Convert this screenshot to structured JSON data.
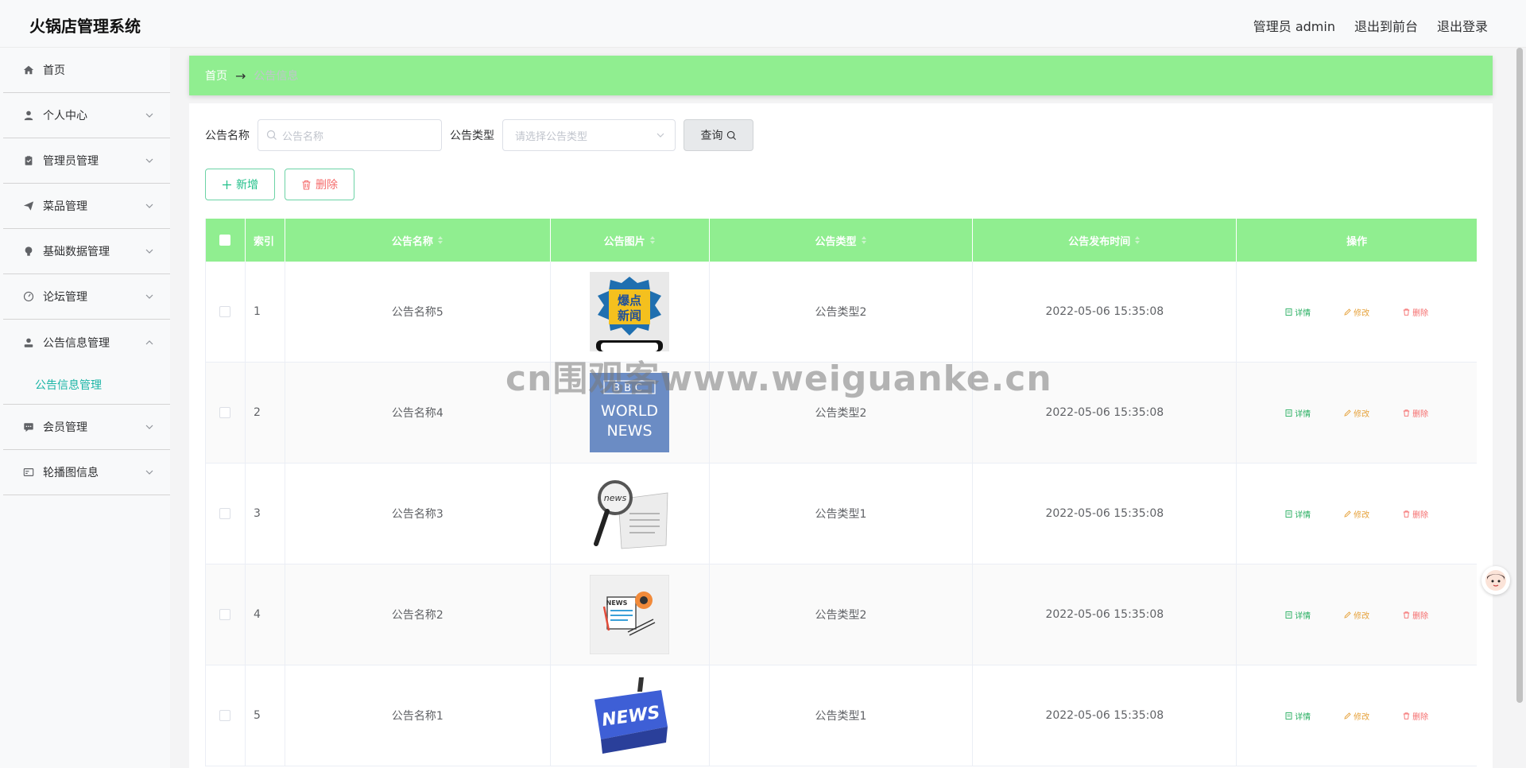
{
  "header": {
    "title": "火锅店管理系统",
    "user": "管理员 admin",
    "to_front": "退出到前台",
    "logout": "退出登录"
  },
  "sidebar": {
    "items": [
      {
        "label": "首页",
        "icon": "home-icon"
      },
      {
        "label": "个人中心",
        "icon": "user-icon"
      },
      {
        "label": "管理员管理",
        "icon": "clipboard-icon"
      },
      {
        "label": "菜品管理",
        "icon": "send-icon"
      },
      {
        "label": "基础数据管理",
        "icon": "bulb-icon"
      },
      {
        "label": "论坛管理",
        "icon": "gauge-icon"
      },
      {
        "label": "公告信息管理",
        "icon": "user-solid-icon"
      },
      {
        "label": "会员管理",
        "icon": "chat-icon"
      },
      {
        "label": "轮播图信息",
        "icon": "card-icon"
      }
    ],
    "submenu_active": "公告信息管理"
  },
  "breadcrumb": {
    "home": "首页",
    "arrow": "→",
    "current": "公告信息"
  },
  "search": {
    "name_label": "公告名称",
    "name_placeholder": "公告名称",
    "type_label": "公告类型",
    "type_placeholder": "请选择公告类型",
    "query_button": "查询"
  },
  "actions": {
    "add": "新增",
    "delete": "删除"
  },
  "table": {
    "headers": {
      "index": "索引",
      "name": "公告名称",
      "image": "公告图片",
      "type": "公告类型",
      "time": "公告发布时间",
      "ops": "操作"
    },
    "op_labels": {
      "detail": "详情",
      "edit": "修改",
      "delete": "删除"
    },
    "rows": [
      {
        "index": "1",
        "name": "公告名称5",
        "type": "公告类型2",
        "time": "2022-05-06 15:35:08",
        "image_text": [
          "爆点",
          "新闻"
        ]
      },
      {
        "index": "2",
        "name": "公告名称4",
        "type": "公告类型2",
        "time": "2022-05-06 15:35:08",
        "image_text": [
          "BBC",
          "WORLD",
          "NEWS"
        ]
      },
      {
        "index": "3",
        "name": "公告名称3",
        "type": "公告类型1",
        "time": "2022-05-06 15:35:08",
        "image_text": [
          "news"
        ]
      },
      {
        "index": "4",
        "name": "公告名称2",
        "type": "公告类型2",
        "time": "2022-05-06 15:35:08",
        "image_text": [
          "NEWS"
        ]
      },
      {
        "index": "5",
        "name": "公告名称1",
        "type": "公告类型1",
        "time": "2022-05-06 15:35:08",
        "image_text": [
          "NEWS"
        ]
      }
    ]
  },
  "watermark": "cn围观客www.weiguanke.cn",
  "colors": {
    "accent": "#90ee90",
    "active_text": "#1bb5a6",
    "detail": "#27ae60",
    "edit": "#e6a23c",
    "danger": "#f56c6c"
  }
}
